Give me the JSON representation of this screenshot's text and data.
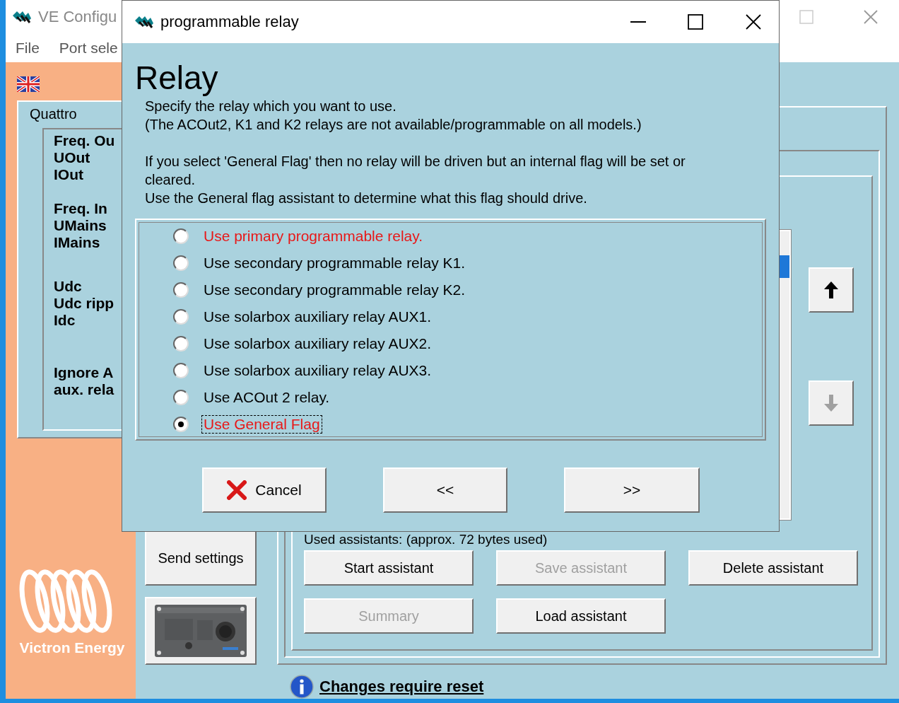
{
  "main_window": {
    "title": "VE Configu",
    "menu": [
      {
        "label": "File"
      },
      {
        "label": "Port sele"
      }
    ],
    "device_panel": {
      "title": "Quattro",
      "groups": [
        [
          "Freq. Ou",
          "UOut",
          "IOut"
        ],
        [
          "Freq. In",
          "UMains",
          "IMains"
        ],
        [
          "Udc",
          "Udc ripp",
          "Idc"
        ],
        [
          "Ignore A",
          "aux. rela"
        ]
      ]
    },
    "logo_text": "Victron Energy",
    "send_button": "Send settings",
    "move_buttons": [
      {
        "kind": "up",
        "disabled": false
      },
      {
        "kind": "down",
        "disabled": true
      }
    ],
    "assistants_label": "Used assistants: (approx. 72 bytes used)",
    "assistant_buttons": [
      {
        "label": "Start assistant",
        "disabled": false
      },
      {
        "label": "Save assistant",
        "disabled": true
      },
      {
        "label": "Delete assistant",
        "disabled": false
      },
      {
        "label": "Summary",
        "disabled": true
      },
      {
        "label": "Load assistant",
        "disabled": false
      }
    ],
    "link": "Changes require reset"
  },
  "dialog": {
    "title": "programmable relay",
    "heading": "Relay",
    "intro_lines": [
      "Specify the relay which you want to use.",
      "(The ACOut2, K1 and K2 relays are not available/programmable on all models.)"
    ],
    "flag_lines": [
      "If you select 'General Flag' then no relay will be driven but an internal flag will be set or cleared.",
      "Use the General flag assistant to determine what this flag should drive."
    ],
    "options": [
      {
        "label": "Use primary programmable relay.",
        "selected": false,
        "highlighted": true
      },
      {
        "label": "Use secondary programmable relay K1.",
        "selected": false,
        "highlighted": false
      },
      {
        "label": "Use secondary programmable relay K2.",
        "selected": false,
        "highlighted": false
      },
      {
        "label": "Use solarbox auxiliary relay AUX1.",
        "selected": false,
        "highlighted": false
      },
      {
        "label": "Use solarbox auxiliary relay AUX2.",
        "selected": false,
        "highlighted": false
      },
      {
        "label": "Use solarbox auxiliary relay AUX3.",
        "selected": false,
        "highlighted": false
      },
      {
        "label": "Use ACOut 2 relay.",
        "selected": false,
        "highlighted": false
      },
      {
        "label": "Use General Flag",
        "selected": true,
        "highlighted": true
      }
    ],
    "buttons": [
      {
        "label": "Cancel",
        "kind": "cancel"
      },
      {
        "label": "<<",
        "kind": "plain"
      },
      {
        "label": ">>",
        "kind": "plain"
      }
    ]
  }
}
